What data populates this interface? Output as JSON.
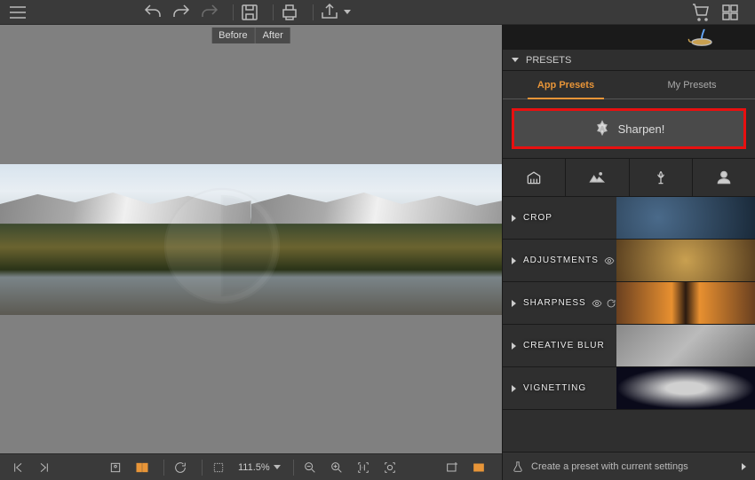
{
  "toolbar": {
    "undo": "undo",
    "redo": "redo",
    "redo2": "redo",
    "save": "save",
    "print": "print",
    "share": "share",
    "cart": "cart",
    "grid": "grid",
    "menu": "menu"
  },
  "viewer": {
    "before_label": "Before",
    "after_label": "After",
    "zoom_level": "111.5%"
  },
  "presets": {
    "header": "PRESETS",
    "tabs": {
      "app": "App Presets",
      "my": "My Presets"
    },
    "sharpen_label": "Sharpen!",
    "categories": [
      "architecture",
      "landscape",
      "macro",
      "portrait"
    ]
  },
  "panels": {
    "crop": "CROP",
    "adjustments": "ADJUSTMENTS",
    "sharpness": "SHARPNESS",
    "creative_blur": "CREATIVE BLUR",
    "vignetting": "VIGNETTING"
  },
  "footer": {
    "create_preset": "Create a preset with current settings"
  }
}
